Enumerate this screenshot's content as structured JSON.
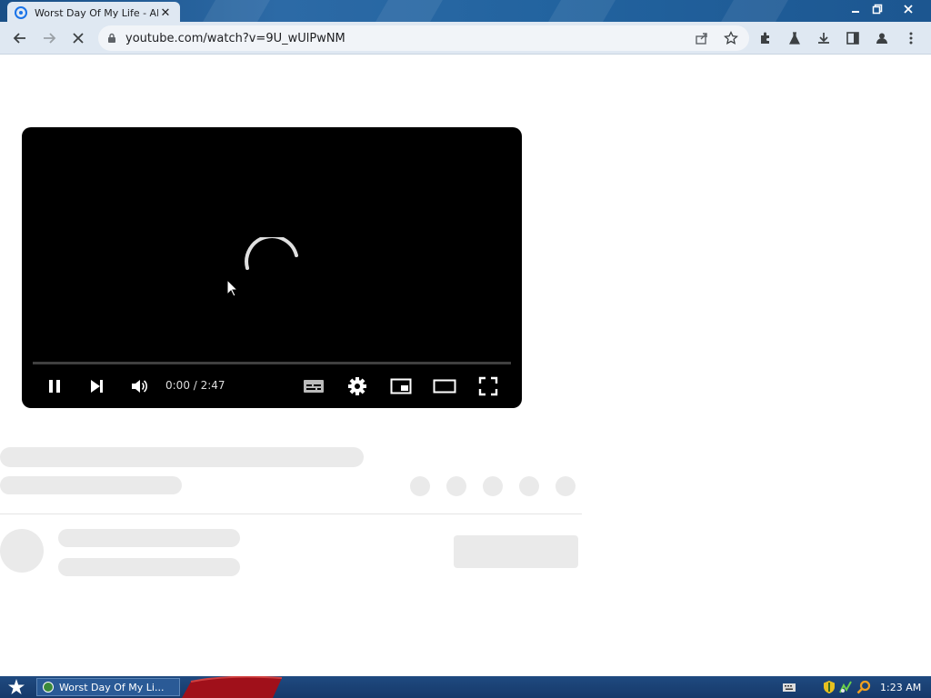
{
  "browser": {
    "tab_title": "Worst Day Of My Life - Al",
    "tab_close": "✕",
    "url": "youtube.com/watch?v=9U_wUlPwNM"
  },
  "window_controls": {
    "minimize": "minimize-icon",
    "restore": "restore-icon",
    "close": "close-icon"
  },
  "player": {
    "time": "0:00 / 2:47",
    "state": "loading",
    "progress": 0
  },
  "taskbar": {
    "task_label": "Worst Day Of My Li...",
    "clock": "1:23 AM"
  },
  "colors": {
    "titlebar": "#1f5c99",
    "toolbar": "#dfe8f2",
    "player_bg": "#000000",
    "skeleton": "#eaeaea",
    "taskbar": "#1b4275"
  }
}
